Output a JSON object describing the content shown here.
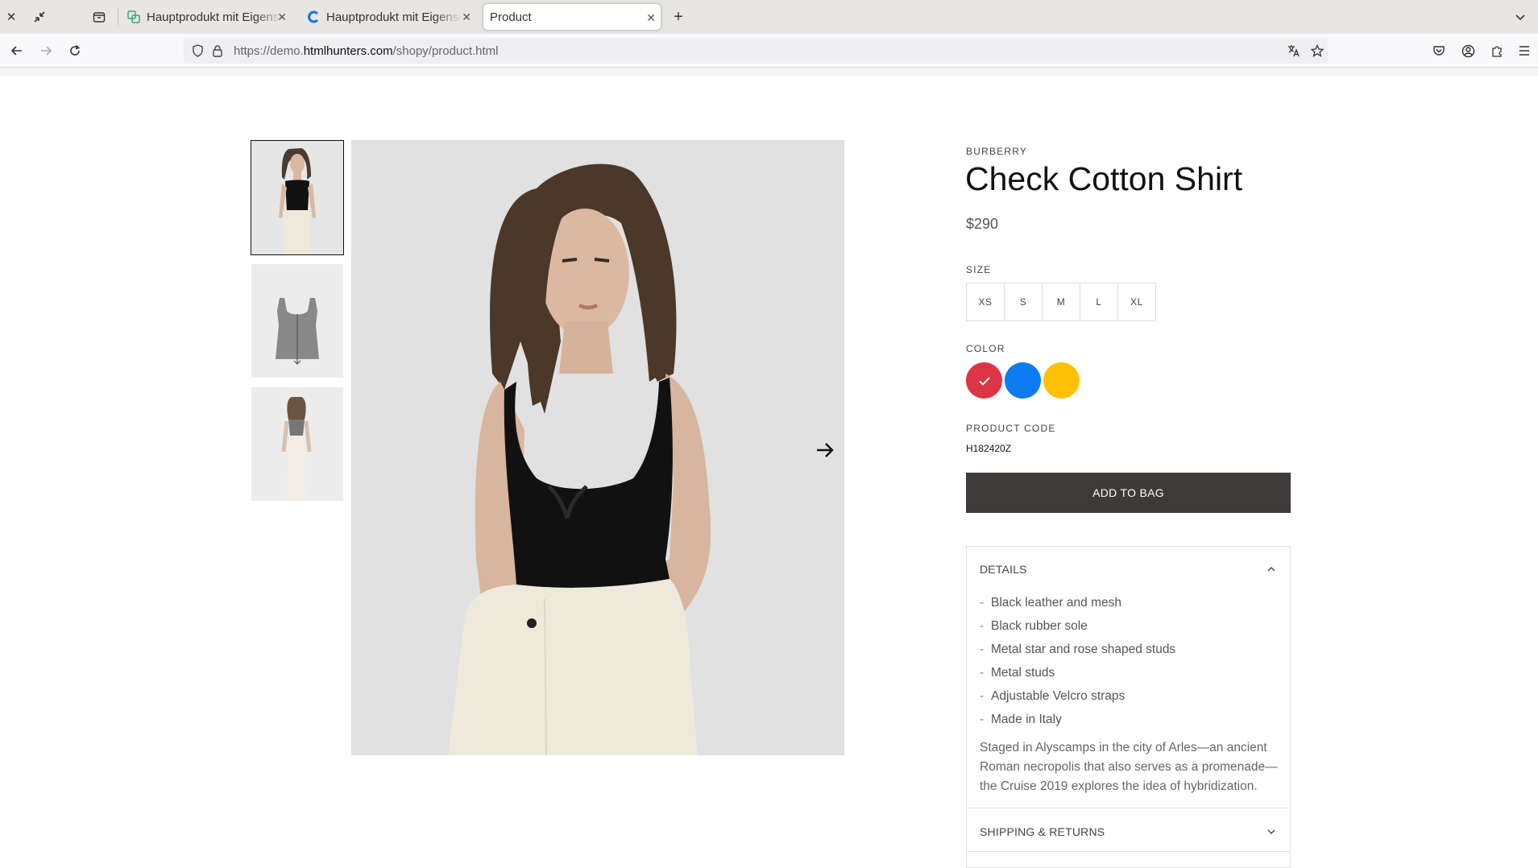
{
  "browser": {
    "tabs": [
      {
        "title": "Hauptprodukt mit Eigenschaften",
        "active": false
      },
      {
        "title": "Hauptprodukt mit Eigenschaften",
        "active": false
      },
      {
        "title": "Product",
        "active": true
      }
    ],
    "url_prefix": "https://demo.",
    "url_domain": "htmlhunters.com",
    "url_path": "/shopy/product.html"
  },
  "product": {
    "brand": "BURBERRY",
    "title": "Check Cotton Shirt",
    "price": "$290",
    "size_label": "SIZE",
    "sizes": [
      "XS",
      "S",
      "M",
      "L",
      "XL"
    ],
    "color_label": "COLOR",
    "colors": [
      {
        "name": "red",
        "hex": "#dc3545",
        "selected": true
      },
      {
        "name": "blue",
        "hex": "#0d7cf2",
        "selected": false
      },
      {
        "name": "yellow",
        "hex": "#ffc107",
        "selected": false
      }
    ],
    "code_label": "PRODUCT CODE",
    "code": "H182420Z",
    "add_to_bag": "ADD TO BAG",
    "details": {
      "heading": "DETAILS",
      "items": [
        "Black leather and mesh",
        "Black rubber sole",
        "Metal star and rose shaped studs",
        "Metal studs",
        "Adjustable Velcro straps",
        "Made in Italy"
      ],
      "description": "Staged in Alyscamps in the city of Arles—an ancient Roman necropolis that also serves as a promenade—the Cruise 2019 explores the idea of hybridization."
    },
    "shipping_heading": "SHIPPING & RETURNS"
  }
}
